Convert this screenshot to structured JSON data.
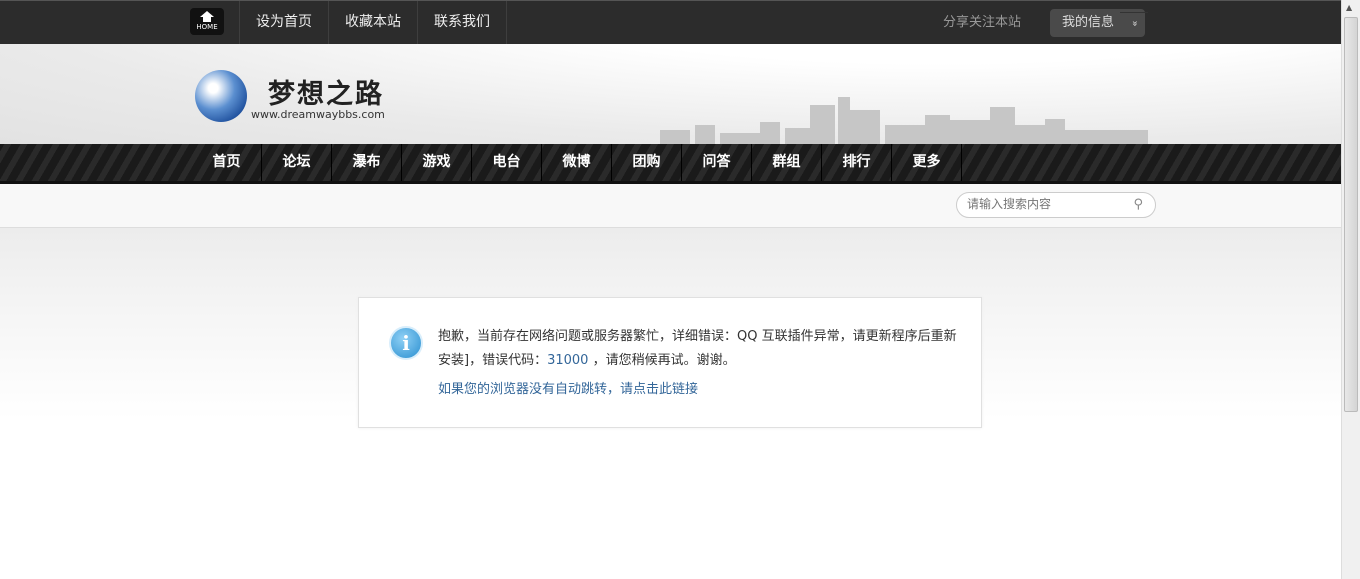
{
  "topbar": {
    "home_label": "HOME",
    "links": [
      "设为首页",
      "收藏本站",
      "联系我们"
    ],
    "share": "分享关注本站",
    "myinfo": "我的信息",
    "myinfo_arrow": "»"
  },
  "header": {
    "logo_text": "梦想之路",
    "logo_url": "www.dreamwaybbs.com"
  },
  "nav": [
    "首页",
    "论坛",
    "瀑布",
    "游戏",
    "电台",
    "微博",
    "团购",
    "问答",
    "群组",
    "排行",
    "更多"
  ],
  "search": {
    "placeholder": "请输入搜索内容",
    "icon": "search-icon"
  },
  "message": {
    "icon": "info-icon",
    "text_before": "抱歉，当前存在网络问题或服务器繁忙，详细错误：QQ 互联插件异常，请更新程序后重新安装]，错误代码：",
    "code": "31000",
    "text_after": " ，请您稍候再试。谢谢。",
    "link": "如果您的浏览器没有自动跳转，请点击此链接"
  }
}
